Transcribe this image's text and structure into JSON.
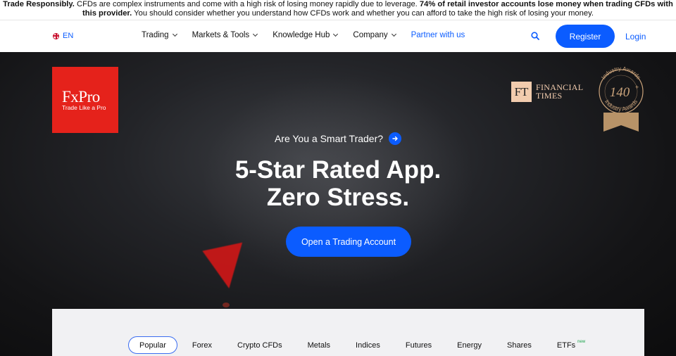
{
  "risk": {
    "p1_bold": "Trade Responsibly.",
    "p1_text": " CFDs are complex instruments and come with a high risk of losing money rapidly due to leverage. ",
    "p2_bold": "74% of retail investor accounts lose money when trading CFDs with this provider.",
    "p3_text": " You should consider whether you understand how CFDs work and whether you can afford to take the high risk of losing your money."
  },
  "nav": {
    "lang": "EN",
    "items": [
      {
        "label": "Trading"
      },
      {
        "label": "Markets & Tools"
      },
      {
        "label": "Knowledge Hub"
      },
      {
        "label": "Company"
      }
    ],
    "partner": "Partner with us",
    "register": "Register",
    "login": "Login"
  },
  "brand": {
    "name": "FxPro",
    "tagline": "Trade Like a Pro",
    "color": "#e5221b"
  },
  "ft": {
    "mark": "FT",
    "line1": "FINANCIAL",
    "line2": "TIMES"
  },
  "award": {
    "top": "Industry Awards",
    "bottom": "Industry Awards",
    "count": "140",
    "plus": "+"
  },
  "hero": {
    "question": "Are You a Smart Trader?",
    "headline1": "5-Star Rated App.",
    "headline2": "Zero Stress.",
    "cta": "Open a Trading Account"
  },
  "markets": {
    "tabs": [
      {
        "label": "Popular",
        "active": true
      },
      {
        "label": "Forex"
      },
      {
        "label": "Crypto CFDs"
      },
      {
        "label": "Metals"
      },
      {
        "label": "Indices"
      },
      {
        "label": "Futures"
      },
      {
        "label": "Energy"
      },
      {
        "label": "Shares"
      },
      {
        "label": "ETFs",
        "badge": "new"
      }
    ]
  },
  "colors": {
    "accent": "#0b5cff",
    "hero_bg": "#1a1b1e"
  }
}
